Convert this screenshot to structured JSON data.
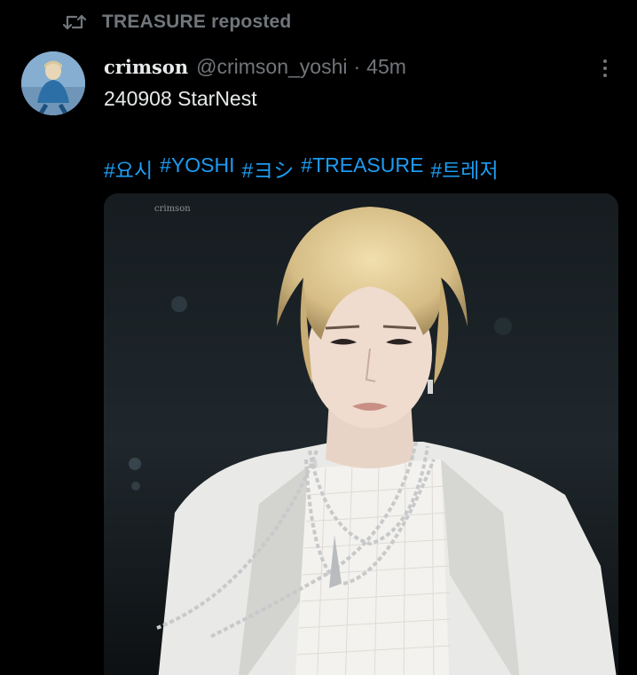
{
  "repost": {
    "label": "TREASURE reposted",
    "icon": "repost-icon"
  },
  "author": {
    "display_name": "crimson",
    "handle": "@crimson_yoshi",
    "separator": "·",
    "time": "45m"
  },
  "post": {
    "text": "240908 StarNest",
    "hashtags": [
      "#요시",
      "#YOSHI",
      "#ヨシ",
      "#TREASURE",
      "#트레저"
    ]
  },
  "media": {
    "watermark": "crimson"
  },
  "colors": {
    "background": "#000000",
    "text_primary": "#e7e9ea",
    "text_secondary": "#71767b",
    "link": "#1d9bf0"
  }
}
